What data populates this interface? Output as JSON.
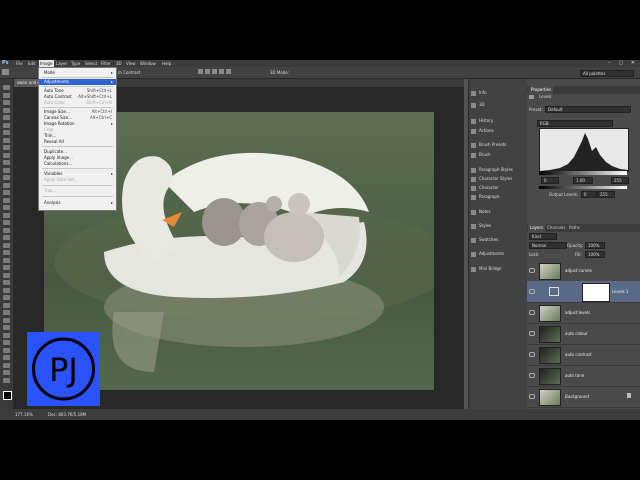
{
  "app": {
    "logo": "Ps"
  },
  "menubar": {
    "items": [
      "File",
      "Edit",
      "Image",
      "Layer",
      "Type",
      "Select",
      "Filter",
      "3D",
      "View",
      "Window",
      "Help"
    ],
    "active": "Image"
  },
  "options": {
    "auto_contrast_label": "m Contrast",
    "mode_3d_label": "3D Mode:",
    "workspace": "All palettes"
  },
  "tab": {
    "label": "swan and cygnets.jpg @ ...ed/8) *"
  },
  "image_menu": {
    "items": [
      {
        "label": "Mode",
        "shortcut": "",
        "submenu": true
      },
      {
        "label": "Adjustments",
        "shortcut": "",
        "submenu": true,
        "highlighted": true
      },
      {
        "label": "Auto Tone",
        "shortcut": "Shift+Ctrl+L"
      },
      {
        "label": "Auto Contrast",
        "shortcut": "Alt+Shift+Ctrl+L"
      },
      {
        "label": "Auto Color",
        "shortcut": "Shift+Ctrl+B",
        "disabled": true
      },
      {
        "label": "Image Size...",
        "shortcut": "Alt+Ctrl+I"
      },
      {
        "label": "Canvas Size...",
        "shortcut": "Alt+Ctrl+C"
      },
      {
        "label": "Image Rotation",
        "shortcut": "",
        "submenu": true
      },
      {
        "label": "Crop",
        "shortcut": "",
        "disabled": true
      },
      {
        "label": "Trim...",
        "shortcut": ""
      },
      {
        "label": "Reveal All",
        "shortcut": ""
      },
      {
        "label": "Duplicate...",
        "shortcut": ""
      },
      {
        "label": "Apply Image...",
        "shortcut": ""
      },
      {
        "label": "Calculations...",
        "shortcut": ""
      },
      {
        "label": "Variables",
        "shortcut": "",
        "submenu": true
      },
      {
        "label": "Apply Data Set...",
        "shortcut": "",
        "disabled": true
      },
      {
        "label": "Trap...",
        "shortcut": "",
        "disabled": true
      },
      {
        "label": "Analysis",
        "shortcut": "",
        "submenu": true
      }
    ]
  },
  "dock": {
    "items": [
      "Info",
      "3D",
      "History",
      "Actions",
      "Brush Presets",
      "Brush",
      "Paragraph Styles",
      "Character Styles",
      "Character",
      "Paragraph",
      "Notes",
      "Styles",
      "Swatches",
      "Adjustments",
      "Mini Bridge"
    ]
  },
  "properties": {
    "tab": "Properties",
    "header": "Levels",
    "preset_label": "Preset:",
    "preset_value": "Default",
    "channel": "RGB",
    "input_values": [
      "0",
      "1.00",
      "255"
    ],
    "output_label": "Output Levels:",
    "output_values": [
      "0",
      "255"
    ]
  },
  "layers": {
    "tabs": [
      "Layers",
      "Channels",
      "Paths"
    ],
    "kind_label": "Kind",
    "blend_mode": "Normal",
    "opacity_label": "Opacity:",
    "opacity_value": "100%",
    "lock_label": "Lock:",
    "fill_label": "Fill:",
    "fill_value": "100%",
    "rows": [
      {
        "name": "adjust curves"
      },
      {
        "name": "Levels 1",
        "selected": true
      },
      {
        "name": "adjust levels"
      },
      {
        "name": "auto colour"
      },
      {
        "name": "auto contrast"
      },
      {
        "name": "auto tone"
      },
      {
        "name": "Background"
      }
    ]
  },
  "status": {
    "zoom": "177.16%",
    "doc": "Doc: 803.7K/5.18M"
  },
  "watermark": {
    "text": "PJ"
  }
}
